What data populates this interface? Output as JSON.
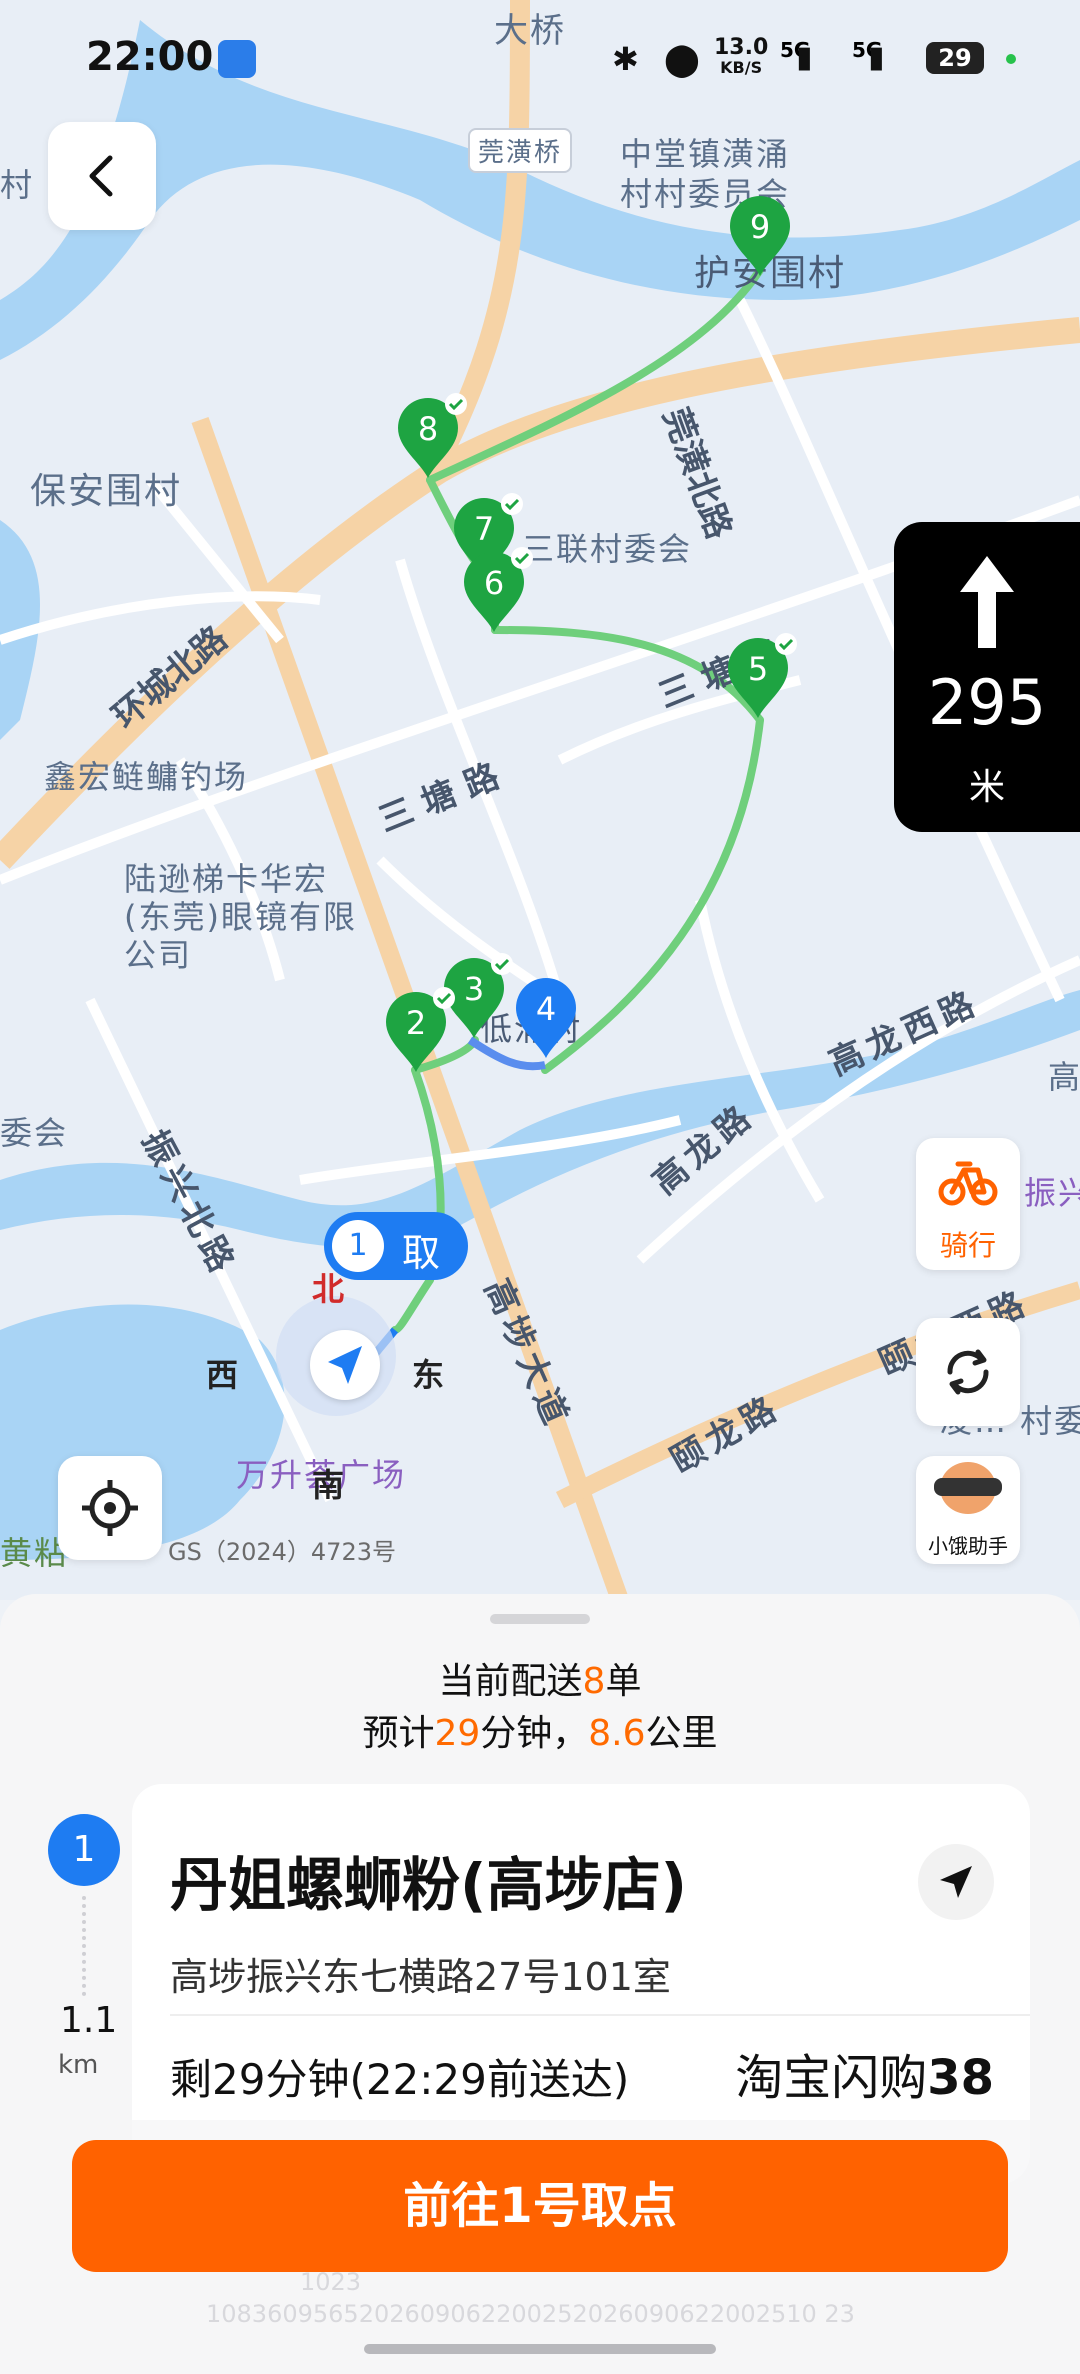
{
  "status_bar": {
    "time": "22:00",
    "net_speed_value": "13.0",
    "net_speed_unit": "KB/S",
    "signal1": "5G",
    "signal2": "5G",
    "battery": "29"
  },
  "map": {
    "labels": {
      "daqiao": "大桥",
      "guanhuang_bridge": "莞潢桥",
      "village_committee_top": "中堂镇潢涌村村委员会",
      "huan_village": "护安围村",
      "guanhuang_north_road": "莞潢北路",
      "baoan_village": "保安围村",
      "sanlian_committee": "三联村委会",
      "huancheng_north_road": "环城北路",
      "santang_road_1": "三塘路",
      "santang_road_2": "三塘路",
      "xinhong_fishery": "鑫宏鲢鳙钓场",
      "luxun_glasses": "陆逊梯卡华宏(东莞)眼镜有限公司",
      "gaolong_west_road": "高龙西路",
      "gaolong_road": "高龙路",
      "zhenxing_north_road": "振兴北路",
      "gaobu_avenue": "高埗大道",
      "yilong_road": "颐龙路",
      "yilong_west_road": "颐龙西路",
      "wansheng_plaza": "万升荟广场",
      "gs_number": "GS（2024）4723号",
      "village_committee_left": "委会",
      "village_committee_right": "凌… 村委",
      "di_village": "低涌村",
      "left_edge_village": "村",
      "bottom_left_village": "黄粘",
      "right_edge_gao": "高",
      "right_edge_zhen": "振兴"
    },
    "compass": {
      "north": "北",
      "south": "南",
      "east": "东",
      "west": "西"
    },
    "pickup_bubble": {
      "number": "1",
      "label": "取"
    },
    "stops": [
      "2",
      "3",
      "4",
      "5",
      "6",
      "7",
      "8",
      "9"
    ]
  },
  "nav_card": {
    "distance": "295",
    "unit": "米"
  },
  "side_buttons": {
    "ride_label": "骑行",
    "assistant_label": "小饿助手"
  },
  "colors": {
    "accent_orange": "#ff6200",
    "route_green": "#6fcf7c",
    "marker_green": "#1ea442",
    "marker_blue": "#1e7cf2"
  },
  "panel": {
    "summary_prefix": "当前配送",
    "order_count": "8",
    "summary_suffix": "单",
    "eta_prefix": "预计",
    "eta_minutes": "29",
    "eta_mid": "分钟，",
    "eta_km": "8.6",
    "eta_unit": "公里",
    "step_number": "1",
    "step_distance": "1.1",
    "step_unit": "km",
    "shop_name": "丹姐螺蛳粉(高埗店)",
    "shop_address": "高埗振兴东七横路27号101室",
    "remaining": "剩29分钟(22:29前送达)",
    "platform_name": "淘宝闪购",
    "platform_number": "38",
    "go_button": "前往1号取点"
  },
  "watermark": {
    "code": "1083609565202609062200252026090622002510 23",
    "short": "1023"
  }
}
